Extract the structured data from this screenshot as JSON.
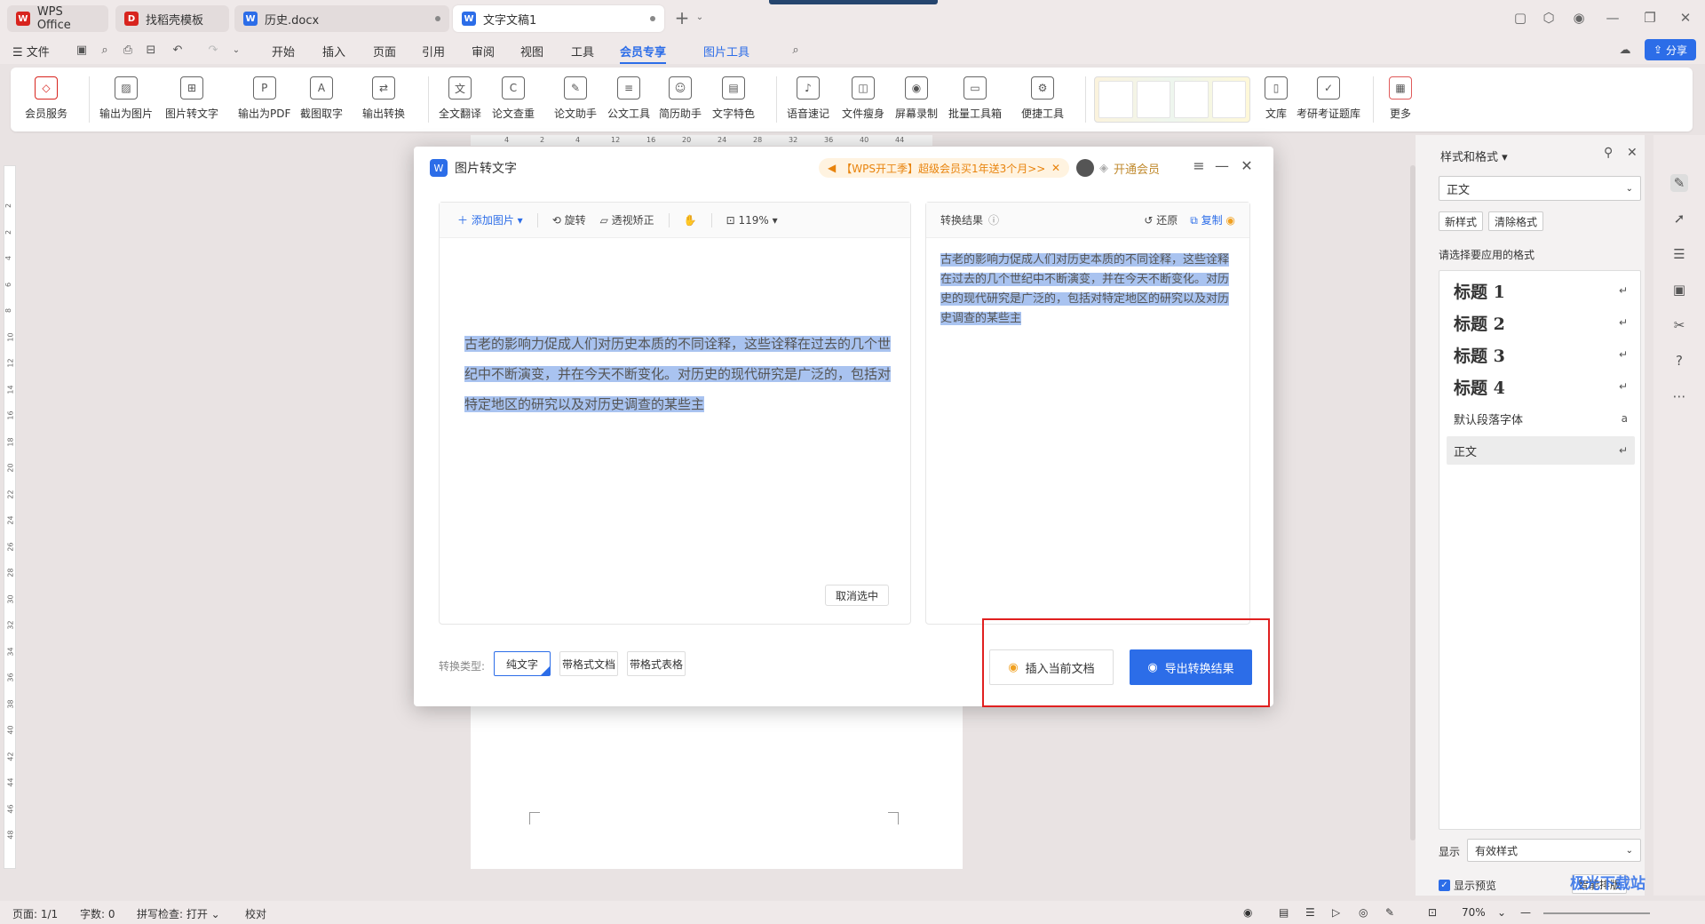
{
  "tabs": [
    {
      "label": "WPS Office",
      "icon": "wps-logo-icon",
      "color": "#d8241e"
    },
    {
      "label": "找稻壳模板",
      "icon": "docer-icon",
      "color": "#d8241e"
    },
    {
      "label": "历史.docx",
      "icon": "word-doc-icon",
      "color": "#2c6de8"
    },
    {
      "label": "文字文稿1",
      "icon": "word-doc-icon",
      "color": "#2c6de8"
    }
  ],
  "menu": {
    "file": "文件",
    "items": [
      "开始",
      "插入",
      "页面",
      "引用",
      "审阅",
      "视图",
      "工具",
      "会员专享",
      "图片工具"
    ],
    "active": "会员专享",
    "share": "分享"
  },
  "ribbon": [
    "会员服务",
    "输出为图片",
    "图片转文字",
    "输出为PDF",
    "截图取字",
    "输出转换",
    "全文翻译",
    "论文查重",
    "论文助手",
    "公文工具",
    "简历助手",
    "文字特色",
    "语音速记",
    "文件瘦身",
    "屏幕录制",
    "批量工具箱",
    "便捷工具",
    "文库",
    "考研考证题库",
    "更多"
  ],
  "ruler_h": [
    "4",
    "2",
    "4",
    "12",
    "16",
    "20",
    "24",
    "28",
    "32",
    "36",
    "40",
    "44"
  ],
  "ruler_v": [
    "2",
    "2",
    "4",
    "6",
    "8",
    "10",
    "12",
    "14",
    "16",
    "18",
    "20",
    "22",
    "24",
    "26",
    "28",
    "30",
    "32",
    "34",
    "36",
    "38",
    "40",
    "42",
    "44",
    "46",
    "48"
  ],
  "dialog": {
    "title": "图片转文字",
    "promo": "【WPS开工季】超级会员买1年送3个月>>",
    "vip": "开通会员",
    "left_toolbar": {
      "add_image": "添加图片",
      "rotate": "旋转",
      "perspective": "透视矫正",
      "zoom": "119%"
    },
    "image_text": "古老的影响力促成人们对历史本质的不同诠释，这些诠释在过去的几个世纪中不断演变，并在今天不断变化。对历史的现代研究是广泛的，包括对特定地区的研究以及对历史调查的某些主",
    "cancel_selection": "取消选中",
    "result_toolbar": {
      "title": "转换结果",
      "restore": "还原",
      "copy": "复制"
    },
    "result_text": "古老的影响力促成人们对历史本质的不同诠释，这些诠释在过去的几个世纪中不断演变，并在今天不断变化。对历史的现代研究是广泛的，包括对特定地区的研究以及对历史调查的某些主",
    "convert_type_label": "转换类型:",
    "convert_types": [
      "纯文字",
      "带格式文档",
      "带格式表格"
    ],
    "convert_selected": "纯文字",
    "insert_button": "插入当前文档",
    "export_button": "导出转换结果"
  },
  "styles_pane": {
    "title": "样式和格式",
    "current_style": "正文",
    "new_style": "新样式",
    "clear_format": "清除格式",
    "apply_prompt": "请选择要应用的格式",
    "items": [
      "标题 1",
      "标题 2",
      "标题 3",
      "标题 4",
      "默认段落字体",
      "正文"
    ],
    "show_label": "显示",
    "show_value": "有效样式",
    "preview_label": "显示预览",
    "smart_btn": "智能排版"
  },
  "status": {
    "page": "页面: 1/1",
    "words": "字数: 0",
    "spell": "拼写检查: 打开",
    "proof": "校对",
    "zoom": "70%"
  },
  "watermark": "极光下载站",
  "accent": "#2c6de8",
  "highlight_box_color": "#e02020"
}
